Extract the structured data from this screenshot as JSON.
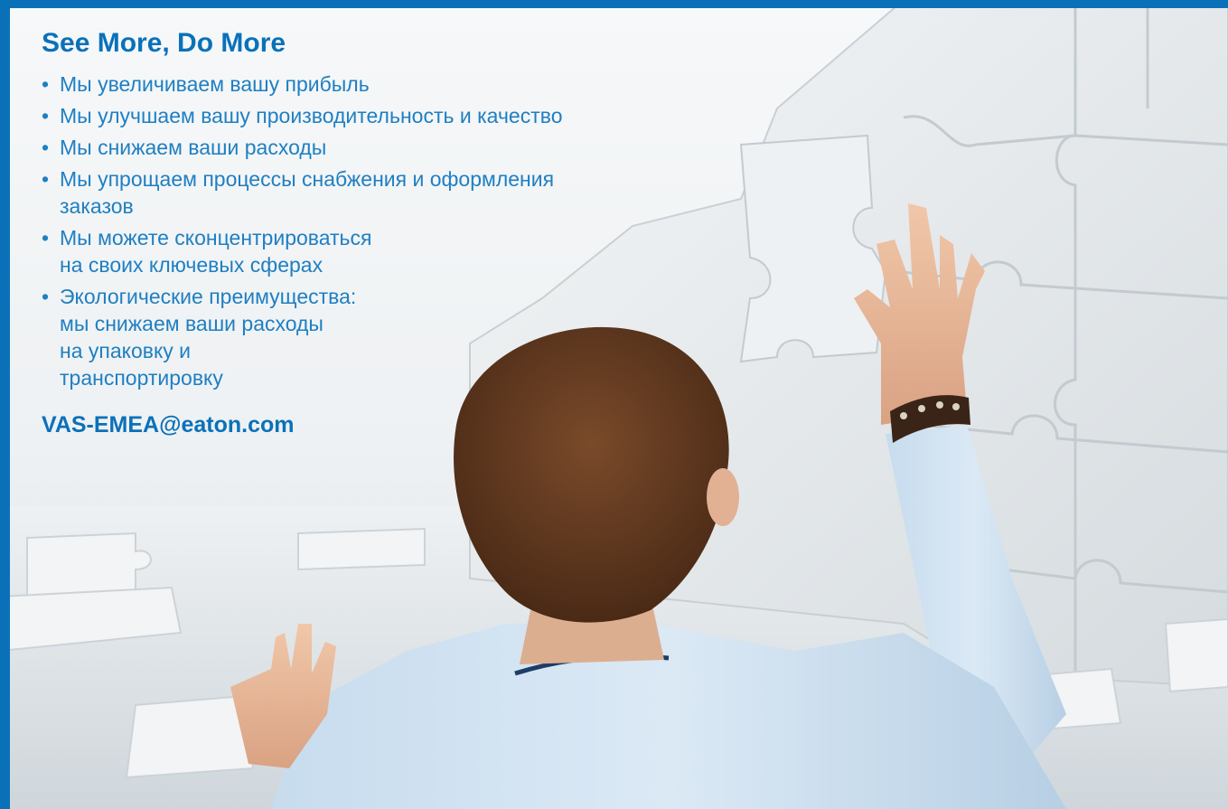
{
  "headline": "See More, Do More",
  "bullet_glyph": "•",
  "bullets": [
    {
      "lines": [
        "Мы увеличиваем вашу прибыль"
      ]
    },
    {
      "lines": [
        "Мы улучшаем вашу производительность и качество"
      ]
    },
    {
      "lines": [
        "Мы снижаем ваши расходы"
      ]
    },
    {
      "lines": [
        "Мы упрощаем процессы снабжения и оформления",
        "заказов"
      ]
    },
    {
      "lines": [
        "Мы можете сконцентрироваться",
        "на своих ключевых сферах"
      ]
    },
    {
      "lines": [
        "Экологические преимущества:",
        "мы снижаем ваши расходы",
        "на упаковку и",
        "транспортировку"
      ]
    }
  ],
  "email": "VAS-EMEA@eaton.com",
  "colors": {
    "brand_blue": "#0a71b9",
    "text_blue": "#1f7fc2"
  }
}
